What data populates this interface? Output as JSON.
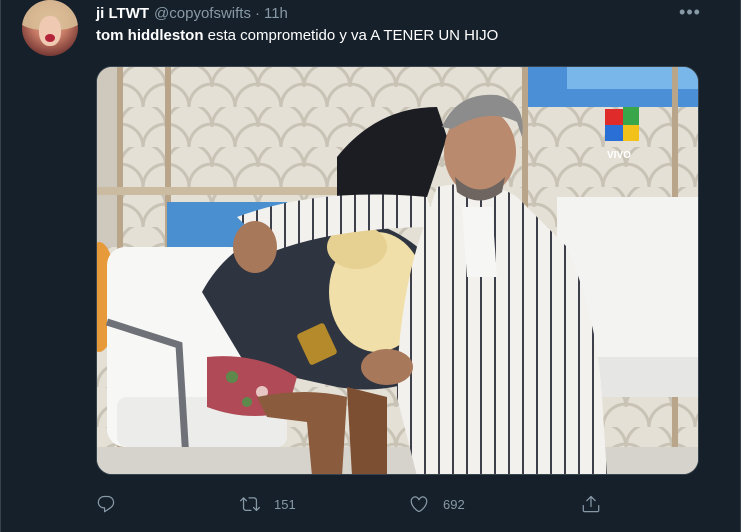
{
  "tweet": {
    "display_name": "ji LTWT",
    "handle": "@copyofswifts",
    "separator": "·",
    "time": "11h",
    "more_label": "•••",
    "text_bold": "tom hiddleston",
    "text_rest": " esta comprometido y va A TENER UN HIJO"
  },
  "media": {
    "watermark": "VIVO"
  },
  "actions": {
    "reply_icon": "reply-icon",
    "retweet_icon": "retweet-icon",
    "retweet_count": "151",
    "like_icon": "heart-icon",
    "like_count": "692",
    "share_icon": "share-icon"
  },
  "colors": {
    "background": "#15202b",
    "text_primary": "#ffffff",
    "text_secondary": "#8899a6",
    "border": "#38444d"
  }
}
